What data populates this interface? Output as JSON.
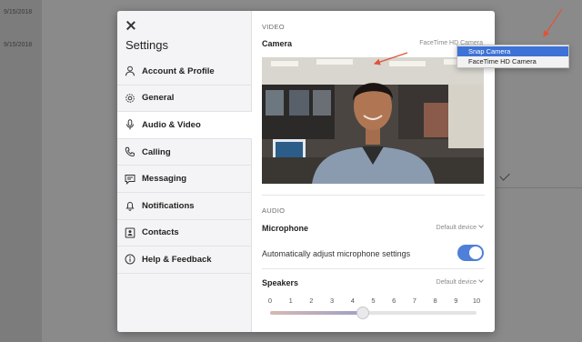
{
  "background": {
    "dates": [
      "9/15/2018",
      "9/15/2018"
    ]
  },
  "modal": {
    "title": "Settings",
    "nav": [
      {
        "label": "Account & Profile",
        "icon": "person-icon",
        "active": false
      },
      {
        "label": "General",
        "icon": "gear-icon",
        "active": false
      },
      {
        "label": "Audio & Video",
        "icon": "microphone-icon",
        "active": true
      },
      {
        "label": "Calling",
        "icon": "phone-icon",
        "active": false
      },
      {
        "label": "Messaging",
        "icon": "chat-icon",
        "active": false
      },
      {
        "label": "Notifications",
        "icon": "bell-icon",
        "active": false
      },
      {
        "label": "Contacts",
        "icon": "contact-card-icon",
        "active": false
      },
      {
        "label": "Help & Feedback",
        "icon": "info-icon",
        "active": false
      }
    ]
  },
  "video": {
    "section_label": "VIDEO",
    "camera_label": "Camera",
    "camera_value": "FaceTime HD Camera"
  },
  "camera_dropdown": {
    "options": [
      "Snap Camera",
      "FaceTime HD Camera"
    ],
    "selected": "Snap Camera"
  },
  "audio": {
    "section_label": "AUDIO",
    "microphone_label": "Microphone",
    "microphone_value": "Default device",
    "auto_adjust_label": "Automatically adjust microphone settings",
    "auto_adjust_on": true,
    "speakers_label": "Speakers",
    "speakers_value": "Default device",
    "volume_ticks": [
      "0",
      "1",
      "2",
      "3",
      "4",
      "5",
      "6",
      "7",
      "8",
      "9",
      "10"
    ],
    "volume_level": 4.5
  },
  "colors": {
    "accent": "#4e7fd9",
    "dropdown_selected": "#3d72d6",
    "annotation": "#e0533a"
  }
}
